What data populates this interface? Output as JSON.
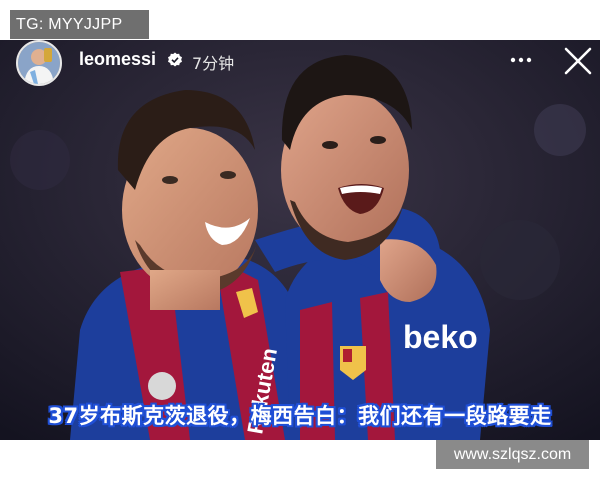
{
  "overlays": {
    "top_left_watermark": "TG: MYYJJPP",
    "bottom_right_watermark": "www.szlqsz.com"
  },
  "story": {
    "username": "leomessi",
    "verified": true,
    "time": "7分钟",
    "caption": "37岁布斯克茨退役，梅西告白：我们还有一段路要走",
    "jersey_text": [
      "beko",
      "Rakuten"
    ],
    "icons": [
      "avatar",
      "verified-badge-icon",
      "more-options-icon",
      "close-icon"
    ]
  },
  "colors": {
    "caption_outline": "#1f4fd6",
    "jersey_blue": "#1d3e9c",
    "jersey_red": "#a3173c",
    "background": "#1b1a28"
  }
}
